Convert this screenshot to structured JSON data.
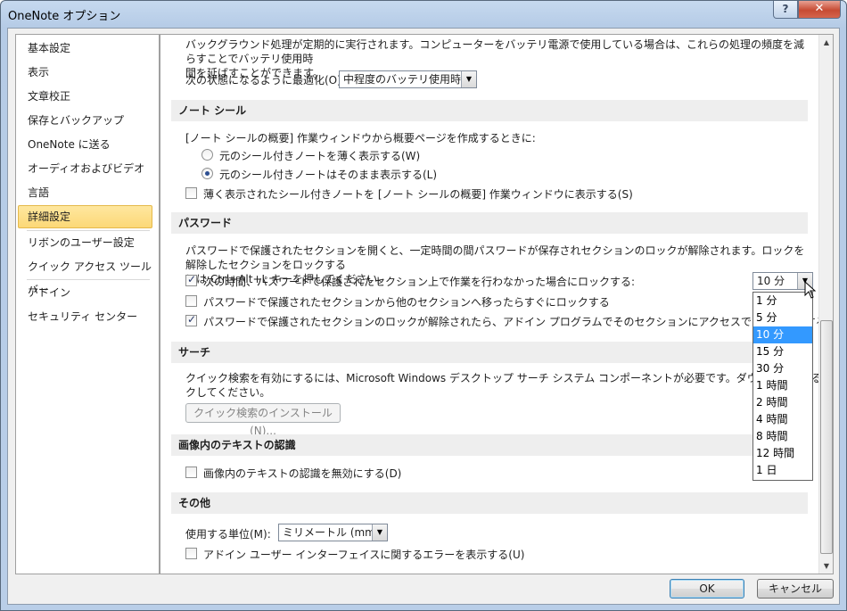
{
  "window": {
    "title": "OneNote オプション",
    "help_label": "?",
    "close_label": "✕"
  },
  "sidebar": {
    "items": [
      {
        "label": "基本設定"
      },
      {
        "label": "表示"
      },
      {
        "label": "文章校正"
      },
      {
        "label": "保存とバックアップ"
      },
      {
        "label": "OneNote に送る"
      },
      {
        "label": "オーディオおよびビデオ"
      },
      {
        "label": "言語"
      },
      {
        "label": "詳細設定",
        "selected": true
      },
      {
        "label": "リボンのユーザー設定"
      },
      {
        "label": "クイック アクセス ツール バー"
      },
      {
        "label": "アドイン"
      },
      {
        "label": "セキュリティ センター"
      }
    ]
  },
  "battery": {
    "desc_line1": "バックグラウンド処理が定期的に実行されます。コンピューターをバッテリ電源で使用している場合は、これらの処理の頻度を減らすことでバッテリ使用時",
    "desc_line2": "間を延ばすことができます。",
    "optimize_label": "次の状態になるように最適化(O):",
    "optimize_value": "中程度のバッテリ使用時間"
  },
  "note_seal": {
    "header": "ノート シール",
    "intro": "[ノート シールの概要] 作業ウィンドウから概要ページを作成するときに:",
    "radio1_label": "元のシール付きノートを薄く表示する(W)",
    "radio2_label": "元のシール付きノートはそのまま表示する(L)",
    "check_label": "薄く表示されたシール付きノートを [ノート シールの概要] 作業ウィンドウに表示する(S)"
  },
  "password": {
    "header": "パスワード",
    "desc_line1": "パスワードで保護されたセクションを開くと、一定時間の間パスワードが保存されセクションのロックが解除されます。ロックを解除したセクションをロックする",
    "desc_line2": "には Ctrl+Alt+L キーを押してください。",
    "lock_after_label": "次の時間、パスワードで保護されたセクション上で作業を行わなかった場合にロックする:",
    "lock_after_value": "10 分",
    "lock_on_leave_label": "パスワードで保護されたセクションから他のセクションへ移ったらすぐにロックする",
    "addin_access_label": "パスワードで保護されたセクションのロックが解除されたら、アドイン プログラムでそのセクションにアクセスできるようにする",
    "options": [
      "1 分",
      "5 分",
      "10 分",
      "15 分",
      "30 分",
      "1 時間",
      "2 時間",
      "4 時間",
      "8 時間",
      "12 時間",
      "1 日"
    ],
    "selected_option": "10 分"
  },
  "search": {
    "header": "サーチ",
    "desc_line1": "クイック検索を有効にするには、Microsoft Windows デスクトップ サーチ システム コンポーネントが必要です。ダウンロードするには、下の",
    "desc_line2": "クしてください。",
    "install_button": "クイック検索のインストール(N)..."
  },
  "ocr": {
    "header": "画像内のテキストの認識",
    "disable_label": "画像内のテキストの認識を無効にする(D)"
  },
  "other": {
    "header": "その他",
    "units_label": "使用する単位(M):",
    "units_value": "ミリメートル (mm)",
    "addin_errors_label": "アドイン ユーザー インターフェイスに関するエラーを表示する(U)"
  },
  "footer": {
    "ok_label": "OK",
    "cancel_label": "キャンセル"
  }
}
